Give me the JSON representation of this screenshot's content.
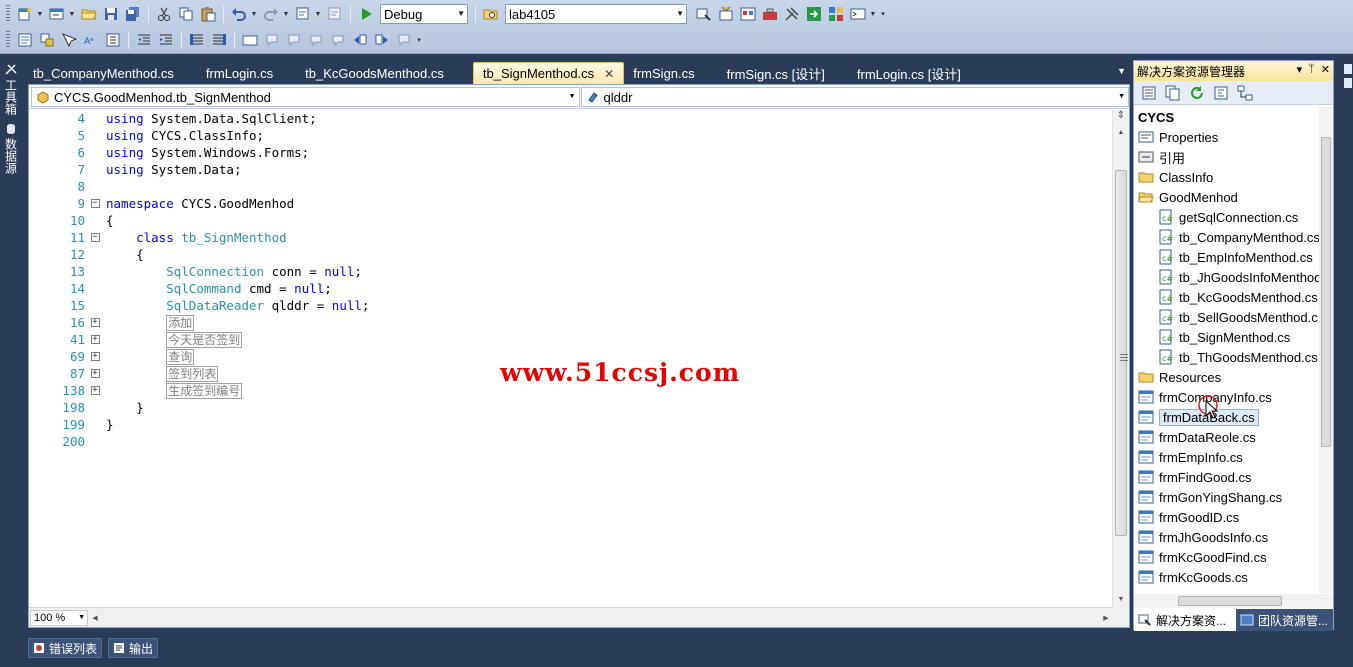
{
  "toolbar": {
    "config_value": "Debug",
    "find_value": "lab4105"
  },
  "left_dock": {
    "toolbox_label": "工具箱",
    "data_sources_label": "数据源"
  },
  "doc_tabs": [
    {
      "label": "tb_CompanyMenthod.cs"
    },
    {
      "label": "frmLogin.cs"
    },
    {
      "label": "tb_KcGoodsMenthod.cs"
    },
    {
      "label": "tb_SignMenthod.cs",
      "close": "✕"
    },
    {
      "label": "frmSign.cs"
    },
    {
      "label": "frmSign.cs [设计]"
    },
    {
      "label": "frmLogin.cs [设计]"
    }
  ],
  "nav": {
    "type_value": "CYCS.GoodMenhod.tb_SignMenthod",
    "member_value": "qlddr"
  },
  "code_lines": [
    {
      "num": "4",
      "parts": [
        {
          "t": "using",
          "c": "kw"
        },
        {
          "t": " System.Data.SqlClient;"
        }
      ]
    },
    {
      "num": "5",
      "parts": [
        {
          "t": "using",
          "c": "kw"
        },
        {
          "t": " CYCS.ClassInfo;"
        }
      ]
    },
    {
      "num": "6",
      "parts": [
        {
          "t": "using",
          "c": "kw"
        },
        {
          "t": " System.Windows.Forms;"
        }
      ]
    },
    {
      "num": "7",
      "parts": [
        {
          "t": "using",
          "c": "kw"
        },
        {
          "t": " System.Data;"
        }
      ]
    },
    {
      "num": "8",
      "parts": []
    },
    {
      "num": "9",
      "fold": "−",
      "parts": [
        {
          "t": "namespace",
          "c": "kw"
        },
        {
          "t": " CYCS.GoodMenhod"
        }
      ]
    },
    {
      "num": "10",
      "parts": [
        {
          "t": "{"
        }
      ]
    },
    {
      "num": "11",
      "fold": "−",
      "parts": [
        {
          "t": "    "
        },
        {
          "t": "class",
          "c": "kw"
        },
        {
          "t": " "
        },
        {
          "t": "tb_SignMenthod",
          "c": "tp"
        }
      ]
    },
    {
      "num": "12",
      "parts": [
        {
          "t": "    {"
        }
      ]
    },
    {
      "num": "13",
      "parts": [
        {
          "t": "        "
        },
        {
          "t": "SqlConnection",
          "c": "tp"
        },
        {
          "t": " conn = "
        },
        {
          "t": "null",
          "c": "kw"
        },
        {
          "t": ";"
        }
      ]
    },
    {
      "num": "14",
      "parts": [
        {
          "t": "        "
        },
        {
          "t": "SqlCommand",
          "c": "tp"
        },
        {
          "t": " cmd = "
        },
        {
          "t": "null",
          "c": "kw"
        },
        {
          "t": ";"
        }
      ]
    },
    {
      "num": "15",
      "parts": [
        {
          "t": "        "
        },
        {
          "t": "SqlDataReader",
          "c": "tp"
        },
        {
          "t": " qlddr = "
        },
        {
          "t": "null",
          "c": "kw"
        },
        {
          "t": ";"
        }
      ]
    },
    {
      "num": "16",
      "fold": "+",
      "parts": [
        {
          "t": "        "
        },
        {
          "t": "添加",
          "c": "collapsed"
        }
      ]
    },
    {
      "num": "41",
      "fold": "+",
      "parts": [
        {
          "t": "        "
        },
        {
          "t": "今天是否签到",
          "c": "collapsed"
        }
      ]
    },
    {
      "num": "69",
      "fold": "+",
      "parts": [
        {
          "t": "        "
        },
        {
          "t": "查询",
          "c": "collapsed"
        }
      ]
    },
    {
      "num": "87",
      "fold": "+",
      "parts": [
        {
          "t": "        "
        },
        {
          "t": "签到列表",
          "c": "collapsed"
        }
      ]
    },
    {
      "num": "138",
      "fold": "+",
      "parts": [
        {
          "t": "        "
        },
        {
          "t": "生成签到编号",
          "c": "collapsed"
        }
      ]
    },
    {
      "num": "198",
      "parts": [
        {
          "t": "    }"
        }
      ]
    },
    {
      "num": "199",
      "parts": [
        {
          "t": "}"
        }
      ]
    },
    {
      "num": "200",
      "parts": []
    }
  ],
  "editor": {
    "zoom": "100 %"
  },
  "watermark": "www.51ccsj.com",
  "solution_explorer": {
    "title": "解决方案资源管理器",
    "title_buttons": [
      "▾",
      "ᛘ",
      "✕"
    ],
    "nodes": [
      {
        "label": "CYCS",
        "level": 0,
        "icon": "project-icon",
        "root": true
      },
      {
        "label": "Properties",
        "level": 1,
        "icon": "properties-icon"
      },
      {
        "label": "引用",
        "level": 1,
        "icon": "references-icon"
      },
      {
        "label": "ClassInfo",
        "level": 1,
        "icon": "folder-icon"
      },
      {
        "label": "GoodMenhod",
        "level": 1,
        "icon": "folder-open-icon"
      },
      {
        "label": "getSqlConnection.cs",
        "level": 2,
        "icon": "cs-file-icon"
      },
      {
        "label": "tb_CompanyMenthod.cs",
        "level": 2,
        "icon": "cs-file-icon"
      },
      {
        "label": "tb_EmpInfoMenthod.cs",
        "level": 2,
        "icon": "cs-file-icon"
      },
      {
        "label": "tb_JhGoodsInfoMenthod",
        "level": 2,
        "icon": "cs-file-icon"
      },
      {
        "label": "tb_KcGoodsMenthod.cs",
        "level": 2,
        "icon": "cs-file-icon"
      },
      {
        "label": "tb_SellGoodsMenthod.c",
        "level": 2,
        "icon": "cs-file-icon"
      },
      {
        "label": "tb_SignMenthod.cs",
        "level": 2,
        "icon": "cs-file-icon"
      },
      {
        "label": "tb_ThGoodsMenthod.cs",
        "level": 2,
        "icon": "cs-file-icon"
      },
      {
        "label": "Resources",
        "level": 1,
        "icon": "folder-icon"
      },
      {
        "label": "frmCompanyInfo.cs",
        "level": 1,
        "icon": "form-icon"
      },
      {
        "label": "frmDataBack.cs",
        "level": 1,
        "icon": "form-icon",
        "selected": true
      },
      {
        "label": "frmDataReole.cs",
        "level": 1,
        "icon": "form-icon"
      },
      {
        "label": "frmEmpInfo.cs",
        "level": 1,
        "icon": "form-icon"
      },
      {
        "label": "frmFindGood.cs",
        "level": 1,
        "icon": "form-icon"
      },
      {
        "label": "frmGonYingShang.cs",
        "level": 1,
        "icon": "form-icon"
      },
      {
        "label": "frmGoodID.cs",
        "level": 1,
        "icon": "form-icon"
      },
      {
        "label": "frmJhGoodsInfo.cs",
        "level": 1,
        "icon": "form-icon"
      },
      {
        "label": "frmKcGoodFind.cs",
        "level": 1,
        "icon": "form-icon"
      },
      {
        "label": "frmKcGoods.cs",
        "level": 1,
        "icon": "form-icon"
      }
    ],
    "tabs": [
      {
        "label": "解决方案资...",
        "active": true
      },
      {
        "label": "团队资源管..."
      }
    ]
  },
  "bottom_tabs": [
    {
      "label": "错误列表"
    },
    {
      "label": "输出"
    }
  ]
}
